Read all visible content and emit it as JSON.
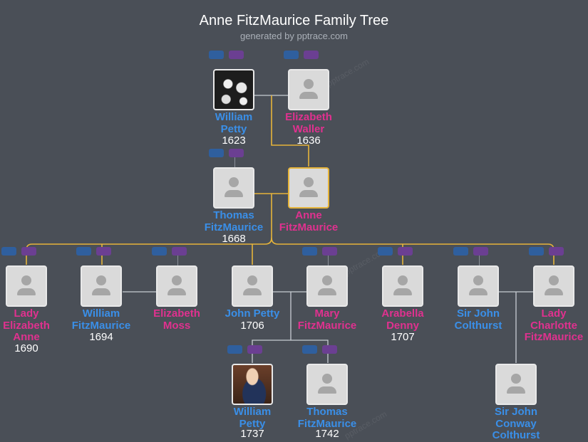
{
  "title": "Anne FitzMaurice Family Tree",
  "subtitle": "generated by pptrace.com",
  "watermark": "pptrace.com",
  "colors": {
    "background": "#4a4f57",
    "male_name": "#3a8fe8",
    "female_name": "#e0318f",
    "highlight_line": "#e6b43a",
    "normal_line": "#c8cdd3"
  },
  "people": {
    "william_petty": {
      "name": [
        "William",
        "Petty"
      ],
      "year": "1623"
    },
    "elizabeth_waller": {
      "name": [
        "Elizabeth",
        "Waller"
      ],
      "year": "1636"
    },
    "thomas_fitzmaurice": {
      "name": [
        "Thomas",
        "FitzMaurice"
      ],
      "year": "1668"
    },
    "anne_fitzmaurice": {
      "name": [
        "Anne",
        "FitzMaurice"
      ],
      "year": ""
    },
    "lady_elizabeth_anne": {
      "name": [
        "Lady",
        "Elizabeth",
        "Anne"
      ],
      "year": "1690"
    },
    "william_fitzmaurice": {
      "name": [
        "William",
        "FitzMaurice"
      ],
      "year": "1694"
    },
    "elizabeth_moss": {
      "name": [
        "Elizabeth",
        "Moss"
      ],
      "year": ""
    },
    "john_petty": {
      "name": [
        "John Petty"
      ],
      "year": "1706"
    },
    "mary_fitzmaurice": {
      "name": [
        "Mary",
        "FitzMaurice"
      ],
      "year": ""
    },
    "arabella_denny": {
      "name": [
        "Arabella",
        "Denny"
      ],
      "year": "1707"
    },
    "sir_john_colthurst": {
      "name": [
        "Sir John",
        "Colthurst"
      ],
      "year": ""
    },
    "lady_charlotte_fitzmaurice": {
      "name": [
        "Lady",
        "Charlotte",
        "FitzMaurice"
      ],
      "year": ""
    },
    "william_petty_1737": {
      "name": [
        "William",
        "Petty"
      ],
      "year": "1737"
    },
    "thomas_fitzmaurice_1742": {
      "name": [
        "Thomas",
        "FitzMaurice"
      ],
      "year": "1742"
    },
    "sir_john_conway_colthurst": {
      "name": [
        "Sir John",
        "Conway",
        "Colthurst"
      ],
      "year": ""
    }
  }
}
